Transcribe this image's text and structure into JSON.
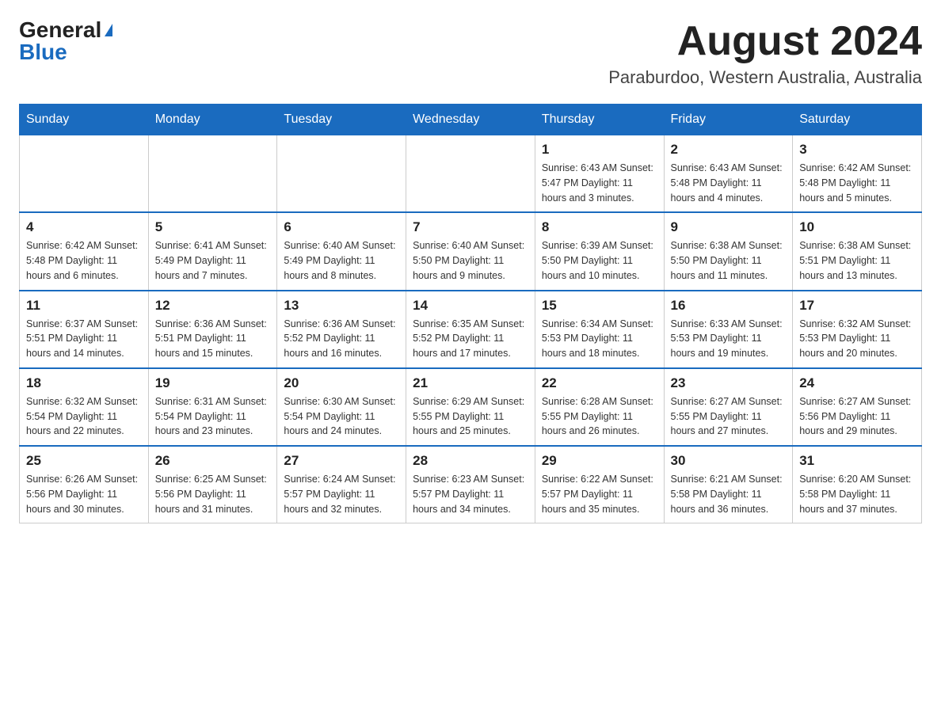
{
  "header": {
    "logo_general": "General",
    "logo_blue": "Blue",
    "month_title": "August 2024",
    "location": "Paraburdoo, Western Australia, Australia"
  },
  "days_of_week": [
    "Sunday",
    "Monday",
    "Tuesday",
    "Wednesday",
    "Thursday",
    "Friday",
    "Saturday"
  ],
  "weeks": [
    {
      "days": [
        {
          "number": "",
          "info": ""
        },
        {
          "number": "",
          "info": ""
        },
        {
          "number": "",
          "info": ""
        },
        {
          "number": "",
          "info": ""
        },
        {
          "number": "1",
          "info": "Sunrise: 6:43 AM\nSunset: 5:47 PM\nDaylight: 11 hours and 3 minutes."
        },
        {
          "number": "2",
          "info": "Sunrise: 6:43 AM\nSunset: 5:48 PM\nDaylight: 11 hours and 4 minutes."
        },
        {
          "number": "3",
          "info": "Sunrise: 6:42 AM\nSunset: 5:48 PM\nDaylight: 11 hours and 5 minutes."
        }
      ]
    },
    {
      "days": [
        {
          "number": "4",
          "info": "Sunrise: 6:42 AM\nSunset: 5:48 PM\nDaylight: 11 hours and 6 minutes."
        },
        {
          "number": "5",
          "info": "Sunrise: 6:41 AM\nSunset: 5:49 PM\nDaylight: 11 hours and 7 minutes."
        },
        {
          "number": "6",
          "info": "Sunrise: 6:40 AM\nSunset: 5:49 PM\nDaylight: 11 hours and 8 minutes."
        },
        {
          "number": "7",
          "info": "Sunrise: 6:40 AM\nSunset: 5:50 PM\nDaylight: 11 hours and 9 minutes."
        },
        {
          "number": "8",
          "info": "Sunrise: 6:39 AM\nSunset: 5:50 PM\nDaylight: 11 hours and 10 minutes."
        },
        {
          "number": "9",
          "info": "Sunrise: 6:38 AM\nSunset: 5:50 PM\nDaylight: 11 hours and 11 minutes."
        },
        {
          "number": "10",
          "info": "Sunrise: 6:38 AM\nSunset: 5:51 PM\nDaylight: 11 hours and 13 minutes."
        }
      ]
    },
    {
      "days": [
        {
          "number": "11",
          "info": "Sunrise: 6:37 AM\nSunset: 5:51 PM\nDaylight: 11 hours and 14 minutes."
        },
        {
          "number": "12",
          "info": "Sunrise: 6:36 AM\nSunset: 5:51 PM\nDaylight: 11 hours and 15 minutes."
        },
        {
          "number": "13",
          "info": "Sunrise: 6:36 AM\nSunset: 5:52 PM\nDaylight: 11 hours and 16 minutes."
        },
        {
          "number": "14",
          "info": "Sunrise: 6:35 AM\nSunset: 5:52 PM\nDaylight: 11 hours and 17 minutes."
        },
        {
          "number": "15",
          "info": "Sunrise: 6:34 AM\nSunset: 5:53 PM\nDaylight: 11 hours and 18 minutes."
        },
        {
          "number": "16",
          "info": "Sunrise: 6:33 AM\nSunset: 5:53 PM\nDaylight: 11 hours and 19 minutes."
        },
        {
          "number": "17",
          "info": "Sunrise: 6:32 AM\nSunset: 5:53 PM\nDaylight: 11 hours and 20 minutes."
        }
      ]
    },
    {
      "days": [
        {
          "number": "18",
          "info": "Sunrise: 6:32 AM\nSunset: 5:54 PM\nDaylight: 11 hours and 22 minutes."
        },
        {
          "number": "19",
          "info": "Sunrise: 6:31 AM\nSunset: 5:54 PM\nDaylight: 11 hours and 23 minutes."
        },
        {
          "number": "20",
          "info": "Sunrise: 6:30 AM\nSunset: 5:54 PM\nDaylight: 11 hours and 24 minutes."
        },
        {
          "number": "21",
          "info": "Sunrise: 6:29 AM\nSunset: 5:55 PM\nDaylight: 11 hours and 25 minutes."
        },
        {
          "number": "22",
          "info": "Sunrise: 6:28 AM\nSunset: 5:55 PM\nDaylight: 11 hours and 26 minutes."
        },
        {
          "number": "23",
          "info": "Sunrise: 6:27 AM\nSunset: 5:55 PM\nDaylight: 11 hours and 27 minutes."
        },
        {
          "number": "24",
          "info": "Sunrise: 6:27 AM\nSunset: 5:56 PM\nDaylight: 11 hours and 29 minutes."
        }
      ]
    },
    {
      "days": [
        {
          "number": "25",
          "info": "Sunrise: 6:26 AM\nSunset: 5:56 PM\nDaylight: 11 hours and 30 minutes."
        },
        {
          "number": "26",
          "info": "Sunrise: 6:25 AM\nSunset: 5:56 PM\nDaylight: 11 hours and 31 minutes."
        },
        {
          "number": "27",
          "info": "Sunrise: 6:24 AM\nSunset: 5:57 PM\nDaylight: 11 hours and 32 minutes."
        },
        {
          "number": "28",
          "info": "Sunrise: 6:23 AM\nSunset: 5:57 PM\nDaylight: 11 hours and 34 minutes."
        },
        {
          "number": "29",
          "info": "Sunrise: 6:22 AM\nSunset: 5:57 PM\nDaylight: 11 hours and 35 minutes."
        },
        {
          "number": "30",
          "info": "Sunrise: 6:21 AM\nSunset: 5:58 PM\nDaylight: 11 hours and 36 minutes."
        },
        {
          "number": "31",
          "info": "Sunrise: 6:20 AM\nSunset: 5:58 PM\nDaylight: 11 hours and 37 minutes."
        }
      ]
    }
  ]
}
